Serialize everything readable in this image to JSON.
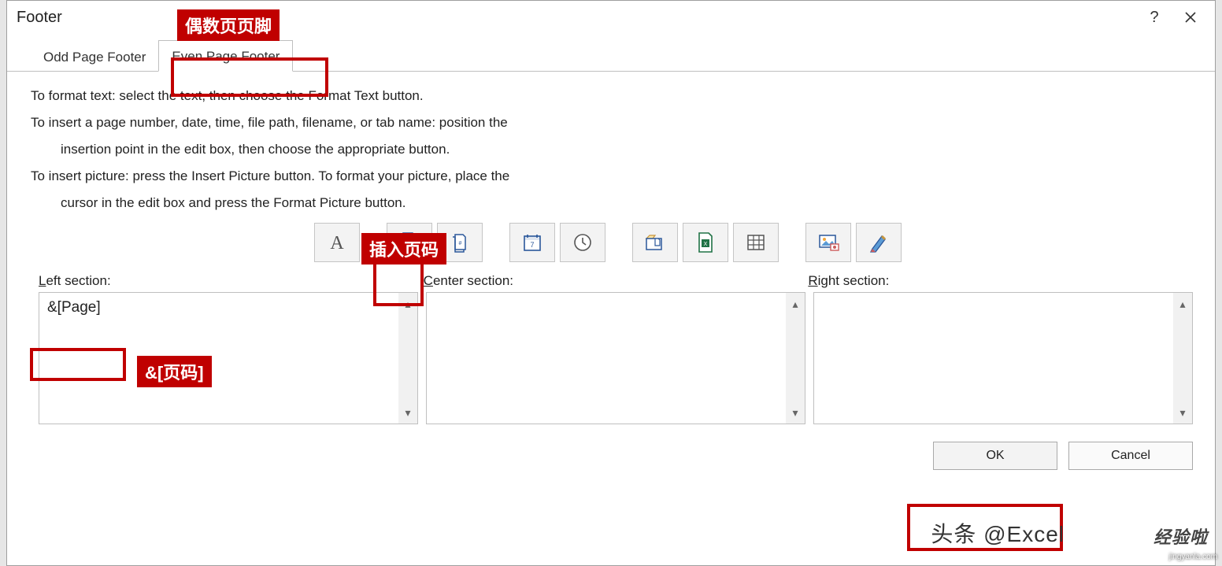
{
  "dialog": {
    "title": "Footer"
  },
  "tabs": {
    "odd": "Odd Page Footer",
    "even": "Even Page Footer"
  },
  "instructions": {
    "line1": "To format text:  select the text, then choose the Format Text button.",
    "line2": "To insert a page number, date, time, file path, filename, or tab name:  position the",
    "line2b": "insertion point in the edit box, then choose the appropriate button.",
    "line3": "To insert picture: press the Insert Picture button.  To format your picture, place the",
    "line3b": "cursor in the edit box and press the Format Picture button."
  },
  "sections": {
    "left_label_u": "L",
    "left_label": "eft section:",
    "center_label_u": "C",
    "center_label": "enter section:",
    "right_label_u": "R",
    "right_label": "ight section:",
    "left_value": "&[Page]"
  },
  "buttons": {
    "ok": "OK",
    "cancel": "Cancel"
  },
  "callouts": {
    "even_footer": "偶数页页脚",
    "insert_page": "插入页码",
    "page_code": "&[页码]"
  },
  "overlay": {
    "toutiao": "头条 @Excel",
    "extra": "经验啦"
  },
  "watermark": "jingyanla.com"
}
